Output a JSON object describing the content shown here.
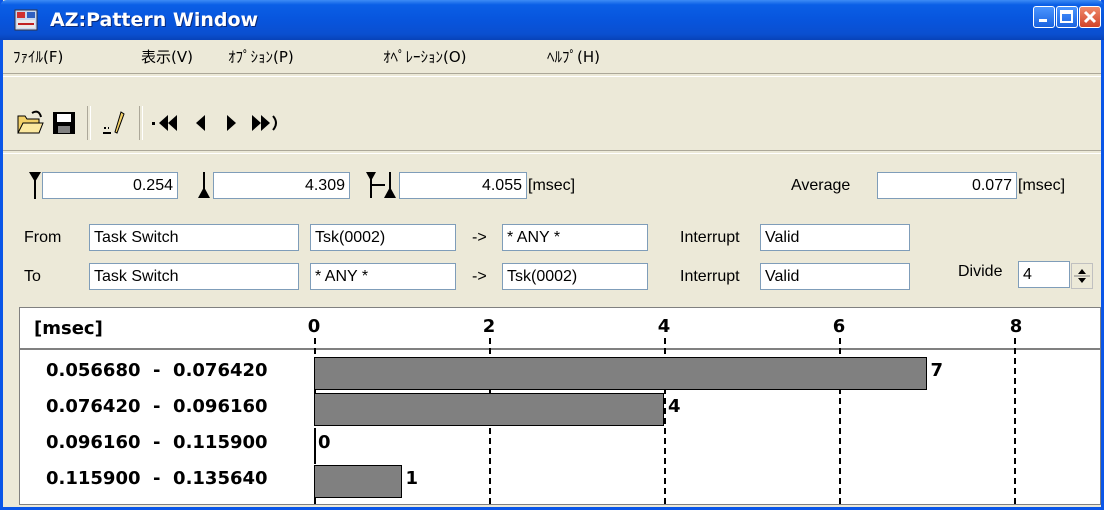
{
  "window": {
    "title": "AZ:Pattern Window"
  },
  "menu": [
    {
      "label": "ﾌｧｲﾙ(F)"
    },
    {
      "label": "表示(V)"
    },
    {
      "label": "ｵﾌﾟｼｮﾝ(P)"
    },
    {
      "label": "ｵﾍﾟﾚｰｼｮﾝ(O)"
    },
    {
      "label": "ﾍﾙﾌﾟ(H)"
    }
  ],
  "toolbar": {
    "icons": [
      "open-folder-icon",
      "save-disk-icon",
      "edit-marker-icon",
      "first-icon",
      "previous-icon",
      "next-icon",
      "last-icon"
    ]
  },
  "markers": {
    "start_value": "0.254",
    "end_value": "4.309",
    "diff_value": "4.055",
    "diff_unit": "[msec]",
    "average_label": "Average",
    "average_value": "0.077",
    "average_unit": "[msec]"
  },
  "from": {
    "label": "From",
    "type": "Task Switch",
    "src": "Tsk(0002)",
    "arrow": "->",
    "dst": "* ANY *",
    "interrupt_label": "Interrupt",
    "interrupt_value": "Valid"
  },
  "to": {
    "label": "To",
    "type": "Task Switch",
    "src": "* ANY *",
    "arrow": "->",
    "dst": "Tsk(0002)",
    "interrupt_label": "Interrupt",
    "interrupt_value": "Valid"
  },
  "divide": {
    "label": "Divide",
    "value": "4"
  },
  "chart_data": {
    "type": "bar",
    "orientation": "horizontal",
    "unit_label": "[msec]",
    "ticks": [
      "0",
      "2",
      "4",
      "6",
      "8"
    ],
    "xlim": [
      0,
      8
    ],
    "grid": "dashed vertical",
    "categories": [
      "0.056680  -  0.076420",
      "0.076420  -  0.096160",
      "0.096160  -  0.115900",
      "0.115900  -  0.135640"
    ],
    "values": [
      7,
      4,
      0,
      1
    ],
    "value_labels": [
      "7",
      "4",
      "0",
      "1"
    ]
  }
}
